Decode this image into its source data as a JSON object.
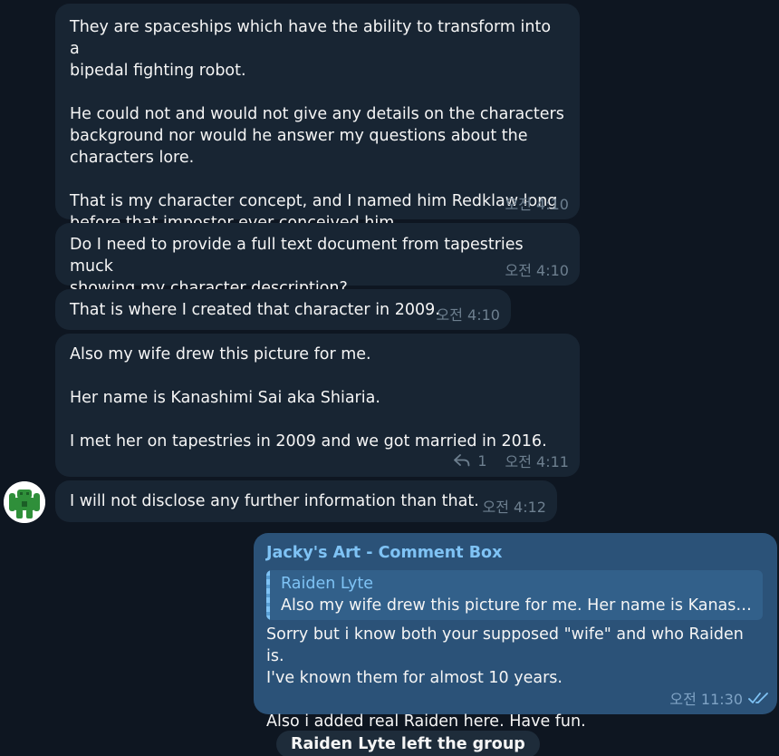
{
  "messages": [
    {
      "text": "They are spaceships which have the ability to transform into a\nbipedal fighting robot.\n\nHe could not and would not give any details on the characters\nbackground nor would he answer my questions about the\ncharacters lore.\n\nThat is my character concept, and I named him Redklaw long\nbefore that impostor ever conceived him.",
      "time": "오전 4:10"
    },
    {
      "text": "Do I need to provide a full text document from tapestries muck\nshowing my character description?",
      "time": "오전 4:10"
    },
    {
      "text": "That is where I created that character in 2009.",
      "time": "오전 4:10"
    },
    {
      "text": "Also my wife drew this picture for me.\n\nHer name is Kanashimi Sai aka Shiaria.\n\nI met her on tapestries in 2009 and we got married in 2016.",
      "time": "오전 4:11",
      "replies": "1"
    },
    {
      "text": "I will not disclose any further information than that.",
      "time": "오전 4:12"
    }
  ],
  "outgoing": {
    "sender": "Jacky's Art - Comment Box",
    "reply_to_name": "Raiden Lyte",
    "reply_to_text": "Also my wife drew this picture for me.  Her name is Kanashi...",
    "text": "Sorry but i know both your supposed \"wife\" and who Raiden is.\nI've known them for almost 10 years.\n\nAlso i added real Raiden here. Have fun.",
    "time": "오전 11:30",
    "status": "read"
  },
  "service_message": "Raiden Lyte left the group",
  "icons": {
    "reply": "reply-arrow-icon",
    "read": "double-check-icon"
  }
}
